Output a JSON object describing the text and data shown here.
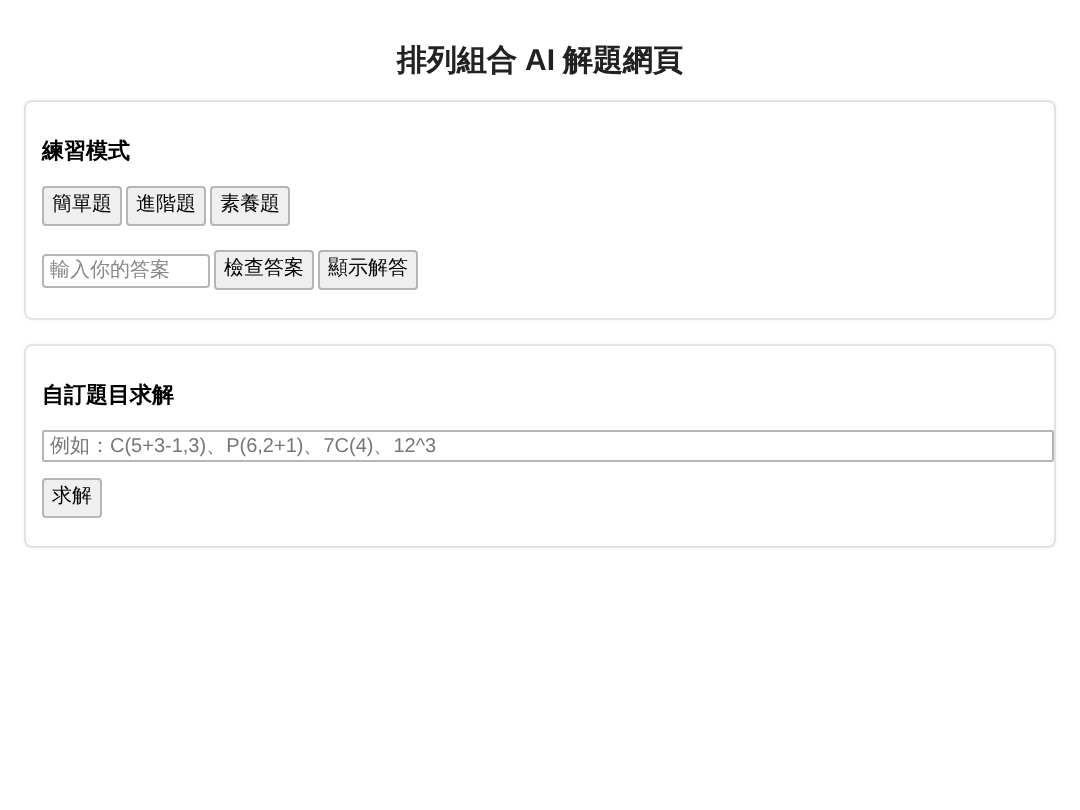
{
  "title": "排列組合 AI 解題網頁",
  "practice": {
    "heading": "練習模式",
    "levels": [
      "簡單題",
      "進階題",
      "素養題"
    ],
    "answer": {
      "placeholder": "輸入你的答案"
    },
    "actions": [
      "檢查答案",
      "顯示解答"
    ]
  },
  "custom": {
    "heading": "自訂題目求解",
    "problem": {
      "placeholder": "例如：C(5+3-1,3)、P(6,2+1)、7C(4)、12^3"
    },
    "solve": "求解"
  }
}
